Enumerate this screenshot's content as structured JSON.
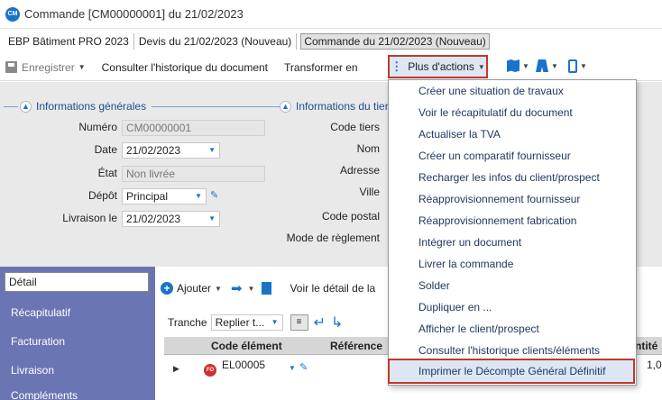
{
  "window": {
    "logo_text": "CM",
    "title": "Commande [CM00000001] du 21/02/2023"
  },
  "tabs": [
    {
      "label": "EBP Bâtiment PRO 2023"
    },
    {
      "label": "Devis du 21/02/2023 (Nouveau)"
    },
    {
      "label": "Commande du 21/02/2023 (Nouveau)"
    }
  ],
  "toolbar": {
    "save_label": "Enregistrer",
    "history_label": "Consulter l'historique du document",
    "transform_label": "Transformer en",
    "more_actions_label": "Plus d'actions"
  },
  "sections": {
    "general": "Informations générales",
    "third_party": "Informations du tiers"
  },
  "general_fields": {
    "numero_label": "Numéro",
    "numero_value": "CM00000001",
    "date_label": "Date",
    "date_value": "21/02/2023",
    "etat_label": "État",
    "etat_value": "Non livrée",
    "depot_label": "Dépôt",
    "depot_value": "Principal",
    "livraison_label": "Livraison le",
    "livraison_value": "21/02/2023"
  },
  "tiers_fields": {
    "code_label": "Code tiers",
    "nom_label": "Nom",
    "adresse_label": "Adresse",
    "ville_label": "Ville",
    "cp_label": "Code postal",
    "reglement_label": "Mode de règlement"
  },
  "nav": [
    "Détail",
    "Récapitulatif",
    "Facturation",
    "Livraison",
    "Compléments"
  ],
  "grid": {
    "add_label": "Ajouter",
    "detail_label": "Voir le détail de la",
    "tranche_label": "Tranche",
    "tranche_value": "Replier t...",
    "col_code": "Code élément",
    "col_ref": "Référence",
    "col_qty": "ntité",
    "row_badge": "FO",
    "row_code": "EL00005",
    "row_qty": "1,0"
  },
  "menu": {
    "items": [
      "Créer une situation de travaux",
      "Voir le récapitulatif du document",
      "Actualiser la TVA",
      "Créer un comparatif fournisseur",
      "Recharger les infos du client/prospect",
      "Réapprovisionnement fournisseur",
      "Réapprovisionnement fabrication",
      "Intégrer un document",
      "Livrer la commande",
      "Solder",
      "Dupliquer en ...",
      "Afficher le client/prospect",
      "Consulter l'historique clients/éléments",
      "Imprimer le Décompte Général Définitif"
    ]
  },
  "colors": {
    "accent": "#1a73c9",
    "highlight_border": "#c0392b",
    "nav_bg": "#6a75b3"
  }
}
